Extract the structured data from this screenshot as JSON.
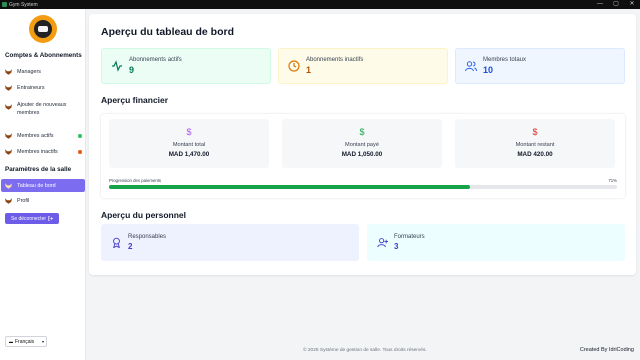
{
  "window": {
    "title": "Gym System",
    "min": "—",
    "max": "▢",
    "close": "✕"
  },
  "sidebar": {
    "section1": "Comptes & Abonnements",
    "items": [
      {
        "label": "Managers"
      },
      {
        "label": "Entraineurs"
      },
      {
        "label": "Ajouter de nouveaux membres"
      },
      {
        "label": "Membres actifs",
        "dot": "#22c55e"
      },
      {
        "label": "Membres inactifs",
        "dot": "#ea580c"
      }
    ],
    "section2": "Paramètres de la salle",
    "items2": [
      {
        "label": "Tableau de bord"
      },
      {
        "label": "Profil"
      }
    ],
    "logout": "Se déconnecter",
    "language": "Français"
  },
  "main": {
    "title": "Aperçu du tableau de bord",
    "stats": [
      {
        "label": "Abonnements actifs",
        "value": "9",
        "bg": "#ecfdf5",
        "color": "#047857"
      },
      {
        "label": "Abonnements inactifs",
        "value": "1",
        "bg": "#fefce8",
        "color": "#b45309"
      },
      {
        "label": "Membres totaux",
        "value": "10",
        "bg": "#eff6ff",
        "color": "#1d4ed8"
      }
    ],
    "finance_title": "Aperçu financier",
    "finance": [
      {
        "label": "Montant total",
        "value": "MAD 1,470.00",
        "icon_color": "#a855f7"
      },
      {
        "label": "Montant payé",
        "value": "MAD 1,050.00",
        "icon_color": "#16a34a"
      },
      {
        "label": "Montant restant",
        "value": "MAD 420.00",
        "icon_color": "#dc2626"
      }
    ],
    "progress_label": "Progression des paiements",
    "progress_text": "71%",
    "progress_value": 0.71,
    "staff_title": "Aperçu du personnel",
    "staff": [
      {
        "label": "Responsables",
        "value": "2"
      },
      {
        "label": "Formateurs",
        "value": "3"
      }
    ]
  },
  "footer": {
    "copyright": "© 2025 Système de gestion de salle. Tous droits réservés.",
    "credit": "Created By IdriCoding"
  }
}
